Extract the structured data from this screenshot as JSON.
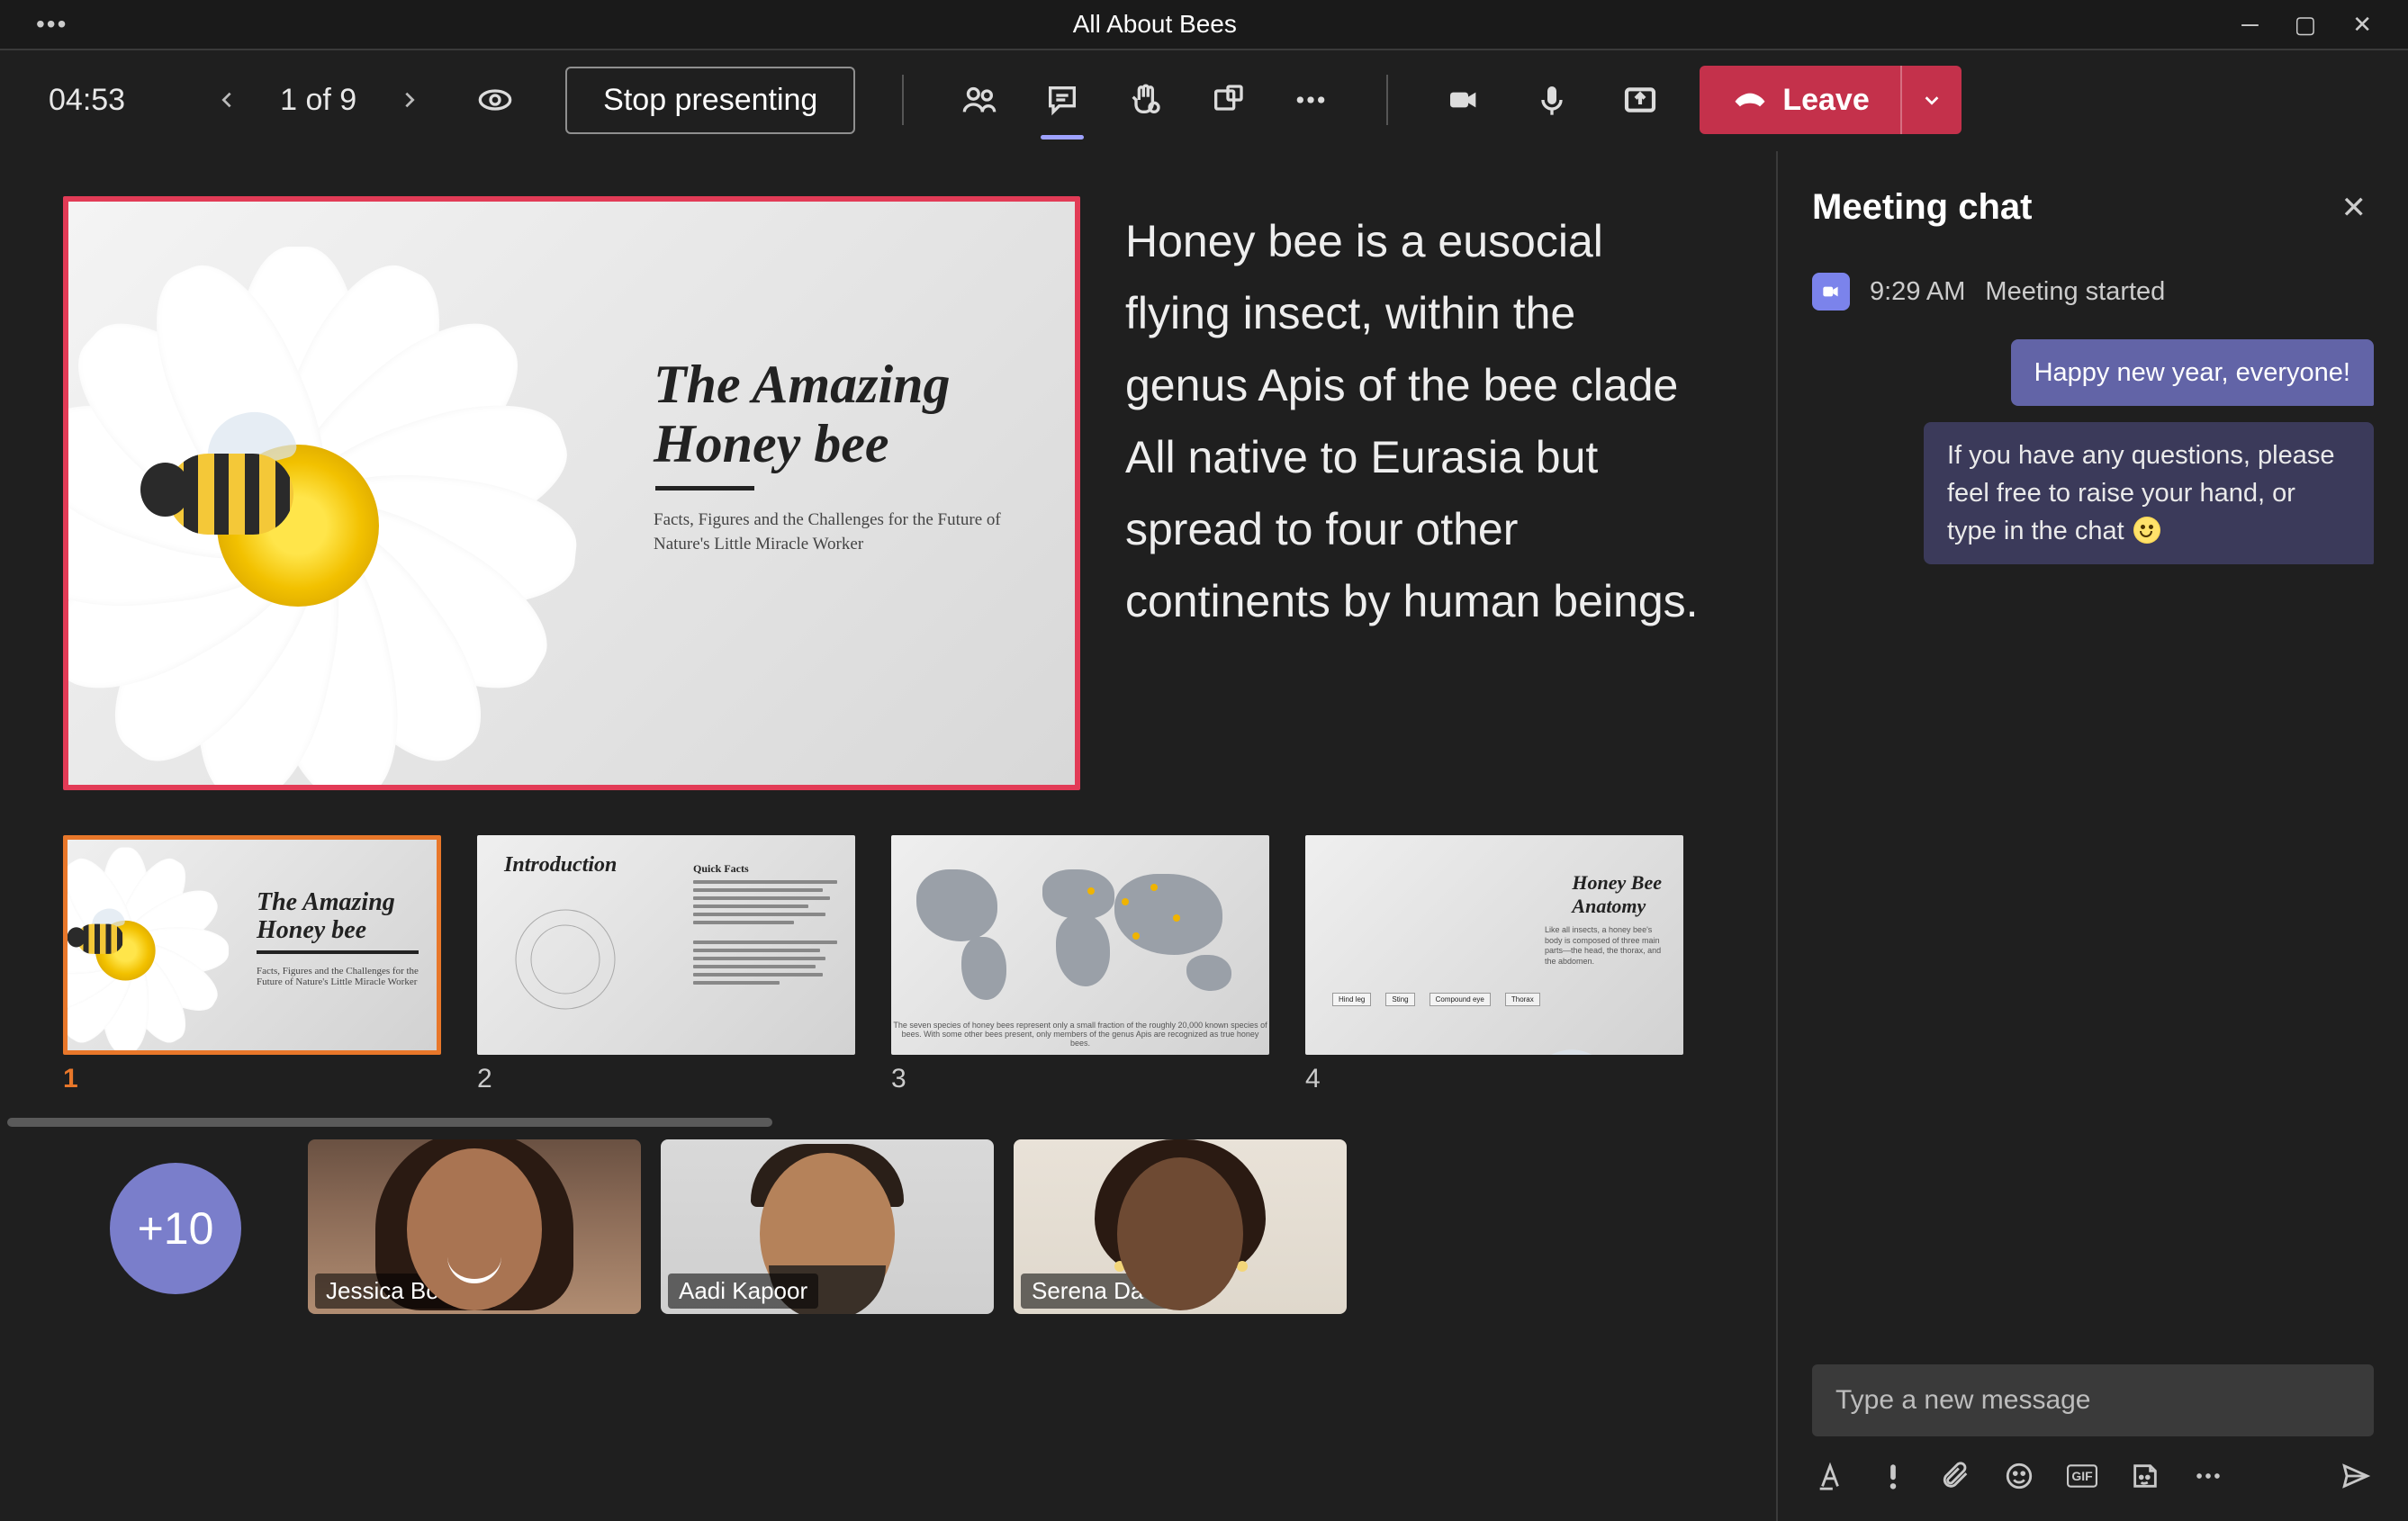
{
  "window": {
    "title": "All About Bees"
  },
  "toolbar": {
    "timer": "04:53",
    "slide_counter": "1 of 9",
    "stop_label": "Stop presenting",
    "leave_label": "Leave"
  },
  "slide": {
    "title_line1": "The Amazing",
    "title_line2": "Honey bee",
    "subtitle": "Facts, Figures and the Challenges for the Future of Nature's Little Miracle Worker"
  },
  "notes": {
    "p1": "Honey bee is a eusocial flying insect, within the genus Apis of the bee clade",
    "p2": "All native to Eurasia but spread to four other continents by human beings."
  },
  "thumbnails": [
    {
      "num": "1",
      "title_l1": "The Amazing",
      "title_l2": "Honey bee",
      "caption": "Facts, Figures and the Challenges for the Future of Nature's Little Miracle Worker"
    },
    {
      "num": "2",
      "title": "Introduction",
      "subhead": "Quick Facts"
    },
    {
      "num": "3",
      "caption": "The seven species of honey bees represent only a small fraction of the roughly 20,000 known species of bees. With some other bees present, only members of the genus Apis are recognized as true honey bees."
    },
    {
      "num": "4",
      "title_l1": "Honey Bee",
      "title_l2": "Anatomy",
      "labels": [
        "Hind leg",
        "Sting",
        "Compound eye",
        "Thorax"
      ]
    }
  ],
  "participants": {
    "extra": "+10",
    "people": [
      {
        "name": "Jessica Booker"
      },
      {
        "name": "Aadi Kapoor"
      },
      {
        "name": "Serena Davis"
      }
    ]
  },
  "chat": {
    "header": "Meeting chat",
    "system": {
      "time": "9:29 AM",
      "text": "Meeting started"
    },
    "messages": [
      {
        "text": "Happy new year, everyone!"
      },
      {
        "text": "If you have any questions, please feel free to raise your hand, or type in the chat "
      }
    ],
    "compose_placeholder": "Type a new message",
    "gif_label": "GIF"
  }
}
